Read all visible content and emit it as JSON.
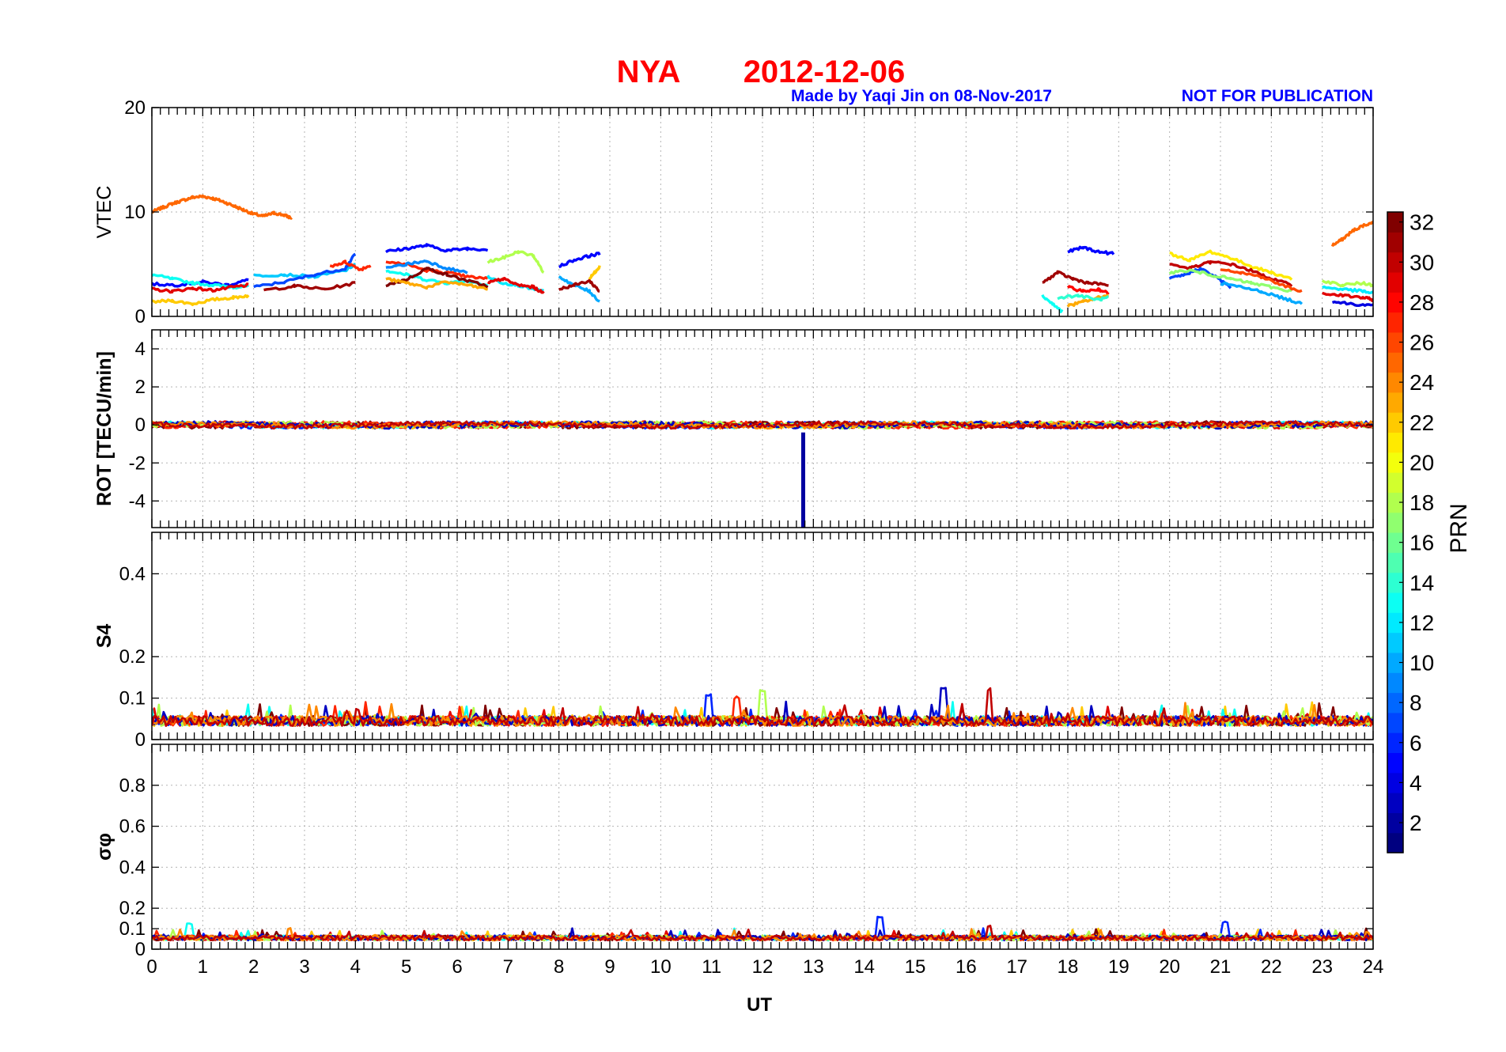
{
  "figure": {
    "station": "NYA",
    "date": "2012-12-06",
    "credit": "Made by Yaqi Jin on 08-Nov-2017",
    "notice": "NOT FOR PUBLICATION",
    "xlabel": "UT",
    "x_ticks": [
      "0",
      "1",
      "2",
      "3",
      "4",
      "5",
      "6",
      "7",
      "8",
      "9",
      "10",
      "11",
      "12",
      "13",
      "14",
      "15",
      "16",
      "17",
      "18",
      "19",
      "20",
      "21",
      "22",
      "23",
      "24"
    ],
    "colors": {
      "title": "#ff0000",
      "credit": "#0000ff",
      "frame": "#000000",
      "grid": "#b3b3b3"
    }
  },
  "colorbar": {
    "label": "PRN",
    "ticks": [
      "2",
      "4",
      "6",
      "8",
      "10",
      "12",
      "14",
      "16",
      "18",
      "20",
      "22",
      "24",
      "26",
      "28",
      "30",
      "32"
    ],
    "range": [
      1,
      32
    ],
    "colormap": "jet"
  },
  "chart_data": [
    {
      "type": "line",
      "panel": "VTEC",
      "ylabel": "VTEC",
      "xlim": [
        0,
        24
      ],
      "ylim": [
        0,
        20
      ],
      "y_ticks": [
        "0",
        "10",
        "20"
      ],
      "grid": true,
      "series": [
        {
          "prn": 25,
          "x": [
            0.0,
            0.2,
            0.4,
            0.6,
            0.8,
            1.0,
            1.2,
            1.4,
            1.6,
            1.8,
            2.0,
            2.2,
            2.4,
            2.6,
            2.75
          ],
          "values": [
            10.0,
            10.4,
            10.8,
            11.1,
            11.4,
            11.5,
            11.3,
            11.0,
            10.6,
            10.2,
            9.8,
            9.6,
            9.9,
            9.7,
            9.4
          ]
        },
        {
          "prn": 25,
          "x": [
            23.2,
            23.4,
            23.6,
            23.8,
            24.0
          ],
          "values": [
            6.8,
            7.4,
            8.2,
            8.7,
            9.0
          ]
        },
        {
          "prn": 5,
          "x": [
            0.0,
            0.5,
            1.0,
            1.5,
            1.9
          ],
          "values": [
            3.1,
            3.0,
            3.3,
            3.0,
            3.5
          ]
        },
        {
          "prn": 13,
          "x": [
            0.0,
            0.4,
            0.8,
            1.2,
            1.6,
            1.9
          ],
          "values": [
            4.0,
            3.6,
            3.2,
            3.0,
            2.8,
            2.9
          ]
        },
        {
          "prn": 29,
          "x": [
            0.0,
            0.4,
            0.8,
            1.2,
            1.6,
            1.9
          ],
          "values": [
            2.6,
            2.4,
            2.7,
            2.5,
            2.8,
            3.0
          ]
        },
        {
          "prn": 22,
          "x": [
            0.0,
            0.4,
            0.8,
            1.2,
            1.6,
            1.9
          ],
          "values": [
            1.4,
            1.5,
            1.2,
            1.6,
            1.8,
            2.0
          ]
        },
        {
          "prn": 11,
          "x": [
            2.0,
            2.6,
            3.2,
            3.8,
            4.0
          ],
          "values": [
            3.9,
            4.0,
            3.8,
            4.4,
            5.0
          ]
        },
        {
          "prn": 7,
          "x": [
            2.0,
            2.6,
            3.2,
            3.8,
            4.0
          ],
          "values": [
            2.8,
            3.3,
            4.0,
            4.6,
            6.0
          ]
        },
        {
          "prn": 31,
          "x": [
            2.2,
            2.8,
            3.4,
            4.0
          ],
          "values": [
            2.5,
            2.9,
            2.6,
            3.2
          ]
        },
        {
          "prn": 27,
          "x": [
            3.5,
            3.8,
            4.1,
            4.3
          ],
          "values": [
            4.8,
            5.2,
            4.5,
            4.9
          ]
        },
        {
          "prn": 5,
          "x": [
            4.6,
            5.0,
            5.4,
            5.8,
            6.2,
            6.6
          ],
          "values": [
            6.2,
            6.5,
            6.8,
            6.3,
            6.5,
            6.4
          ]
        },
        {
          "prn": 13,
          "x": [
            4.6,
            5.0,
            5.4,
            5.8,
            6.2,
            6.6
          ],
          "values": [
            4.4,
            4.0,
            3.5,
            3.2,
            3.4,
            3.0
          ]
        },
        {
          "prn": 27,
          "x": [
            4.6,
            5.0,
            5.4,
            5.8,
            6.2,
            6.6
          ],
          "values": [
            5.2,
            5.0,
            4.4,
            4.2,
            3.8,
            3.6
          ]
        },
        {
          "prn": 32,
          "x": [
            4.6,
            5.0,
            5.4,
            5.8,
            6.2,
            6.6
          ],
          "values": [
            3.0,
            3.5,
            4.6,
            4.0,
            3.4,
            2.9
          ]
        },
        {
          "prn": 9,
          "x": [
            4.6,
            5.0,
            5.4,
            5.8,
            6.2
          ],
          "values": [
            4.6,
            5.0,
            5.3,
            4.6,
            4.2
          ]
        },
        {
          "prn": 23,
          "x": [
            4.6,
            5.0,
            5.4,
            5.8,
            6.2,
            6.6
          ],
          "values": [
            3.6,
            3.2,
            2.8,
            3.3,
            3.0,
            2.6
          ]
        },
        {
          "prn": 18,
          "x": [
            6.6,
            6.9,
            7.2,
            7.5,
            7.7
          ],
          "values": [
            5.2,
            5.6,
            6.2,
            5.8,
            4.2
          ]
        },
        {
          "prn": 12,
          "x": [
            6.6,
            6.9,
            7.2,
            7.5,
            7.7
          ],
          "values": [
            3.8,
            3.2,
            3.0,
            2.6,
            2.4
          ]
        },
        {
          "prn": 29,
          "x": [
            6.6,
            6.9,
            7.2,
            7.5,
            7.7
          ],
          "values": [
            3.2,
            3.6,
            3.0,
            2.8,
            2.2
          ]
        },
        {
          "prn": 5,
          "x": [
            8.0,
            8.3,
            8.6,
            8.8
          ],
          "values": [
            4.8,
            5.4,
            5.8,
            6.0
          ]
        },
        {
          "prn": 10,
          "x": [
            8.0,
            8.3,
            8.6,
            8.8
          ],
          "values": [
            3.8,
            3.0,
            2.4,
            1.4
          ]
        },
        {
          "prn": 31,
          "x": [
            8.0,
            8.3,
            8.6,
            8.8
          ],
          "values": [
            2.6,
            3.0,
            3.4,
            2.4
          ]
        },
        {
          "prn": 22,
          "x": [
            8.6,
            8.7,
            8.8
          ],
          "values": [
            3.6,
            4.2,
            4.8
          ]
        },
        {
          "prn": 13,
          "x": [
            17.5,
            17.7,
            17.9
          ],
          "values": [
            2.0,
            1.2,
            0.4
          ]
        },
        {
          "prn": 5,
          "x": [
            18.0,
            18.3,
            18.6,
            18.9
          ],
          "values": [
            6.2,
            6.6,
            6.2,
            6.0
          ]
        },
        {
          "prn": 31,
          "x": [
            17.5,
            17.8,
            18.1,
            18.4,
            18.8
          ],
          "values": [
            3.2,
            4.2,
            3.6,
            3.2,
            3.0
          ]
        },
        {
          "prn": 28,
          "x": [
            18.0,
            18.3,
            18.6,
            18.8
          ],
          "values": [
            2.8,
            2.4,
            2.6,
            2.2
          ]
        },
        {
          "prn": 23,
          "x": [
            18.0,
            18.3,
            18.6,
            18.8
          ],
          "values": [
            1.0,
            1.4,
            1.8,
            2.0
          ]
        },
        {
          "prn": 14,
          "x": [
            17.8,
            18.2,
            18.6,
            18.8
          ],
          "values": [
            1.8,
            2.0,
            1.6,
            1.8
          ]
        },
        {
          "prn": 7,
          "x": [
            20.0,
            20.3,
            20.6,
            20.9,
            21.2
          ],
          "values": [
            3.6,
            4.0,
            4.6,
            3.8,
            2.8
          ]
        },
        {
          "prn": 21,
          "x": [
            20.0,
            20.4,
            20.8,
            21.2,
            21.6,
            22.0,
            22.4
          ],
          "values": [
            6.0,
            5.4,
            6.2,
            5.6,
            4.8,
            4.2,
            3.6
          ]
        },
        {
          "prn": 30,
          "x": [
            20.0,
            20.4,
            20.8,
            21.2,
            21.6,
            22.0,
            22.4
          ],
          "values": [
            5.0,
            4.6,
            5.2,
            5.0,
            4.4,
            3.6,
            3.0
          ]
        },
        {
          "prn": 17,
          "x": [
            20.0,
            20.4,
            20.8,
            21.2,
            21.6,
            22.0,
            22.4
          ],
          "values": [
            4.2,
            4.4,
            4.0,
            3.6,
            3.2,
            2.8,
            2.4
          ]
        },
        {
          "prn": 10,
          "x": [
            21.0,
            21.4,
            21.8,
            22.2,
            22.6
          ],
          "values": [
            3.2,
            2.8,
            2.4,
            1.8,
            1.2
          ]
        },
        {
          "prn": 26,
          "x": [
            21.0,
            21.4,
            21.8,
            22.2,
            22.6
          ],
          "values": [
            4.6,
            4.2,
            3.8,
            3.0,
            2.4
          ]
        },
        {
          "prn": 12,
          "x": [
            23.0,
            23.4,
            23.8,
            24.0
          ],
          "values": [
            2.8,
            2.6,
            2.4,
            2.2
          ]
        },
        {
          "prn": 29,
          "x": [
            23.0,
            23.4,
            23.8,
            24.0
          ],
          "values": [
            2.2,
            2.0,
            1.8,
            1.6
          ]
        },
        {
          "prn": 18,
          "x": [
            23.0,
            23.4,
            23.8,
            24.0
          ],
          "values": [
            3.4,
            3.0,
            3.2,
            3.0
          ]
        },
        {
          "prn": 4,
          "x": [
            23.2,
            23.6,
            24.0
          ],
          "values": [
            1.4,
            1.2,
            1.0
          ]
        }
      ]
    },
    {
      "type": "line",
      "panel": "ROT",
      "ylabel": "ROT [TECU/min]",
      "xlim": [
        0,
        24
      ],
      "ylim": [
        -5.4,
        5.0
      ],
      "y_ticks": [
        "-4",
        "-2",
        "0",
        "2",
        "4"
      ],
      "grid": true,
      "baseline": 0.0,
      "noise": 0.12,
      "spike": {
        "prn": 2,
        "x": 12.8,
        "from": -0.4,
        "to": -5.4
      }
    },
    {
      "type": "line",
      "panel": "S4",
      "ylabel": "S4",
      "xlim": [
        0,
        24
      ],
      "ylim": [
        0,
        0.5
      ],
      "y_ticks": [
        "0",
        "0.1",
        "0.2",
        "0.4"
      ],
      "grid": true,
      "baseline": 0.045,
      "noise": 0.012,
      "peaks": [
        {
          "x": 10.95,
          "value": 0.11
        },
        {
          "x": 11.5,
          "value": 0.11
        },
        {
          "x": 12.0,
          "value": 0.12
        },
        {
          "x": 15.55,
          "value": 0.125
        },
        {
          "x": 16.45,
          "value": 0.13
        }
      ]
    },
    {
      "type": "line",
      "panel": "sigma_phi",
      "ylabel": "σφ",
      "xlim": [
        0,
        24
      ],
      "ylim": [
        0,
        1.0
      ],
      "y_ticks": [
        "0",
        "0.1",
        "0.2",
        "0.4",
        "0.6",
        "0.8"
      ],
      "grid": true,
      "baseline": 0.055,
      "noise": 0.012,
      "peaks": [
        {
          "x": 0.75,
          "value": 0.13
        },
        {
          "x": 2.7,
          "value": 0.11
        },
        {
          "x": 14.3,
          "value": 0.16
        },
        {
          "x": 16.45,
          "value": 0.12
        },
        {
          "x": 21.1,
          "value": 0.14
        }
      ]
    }
  ]
}
